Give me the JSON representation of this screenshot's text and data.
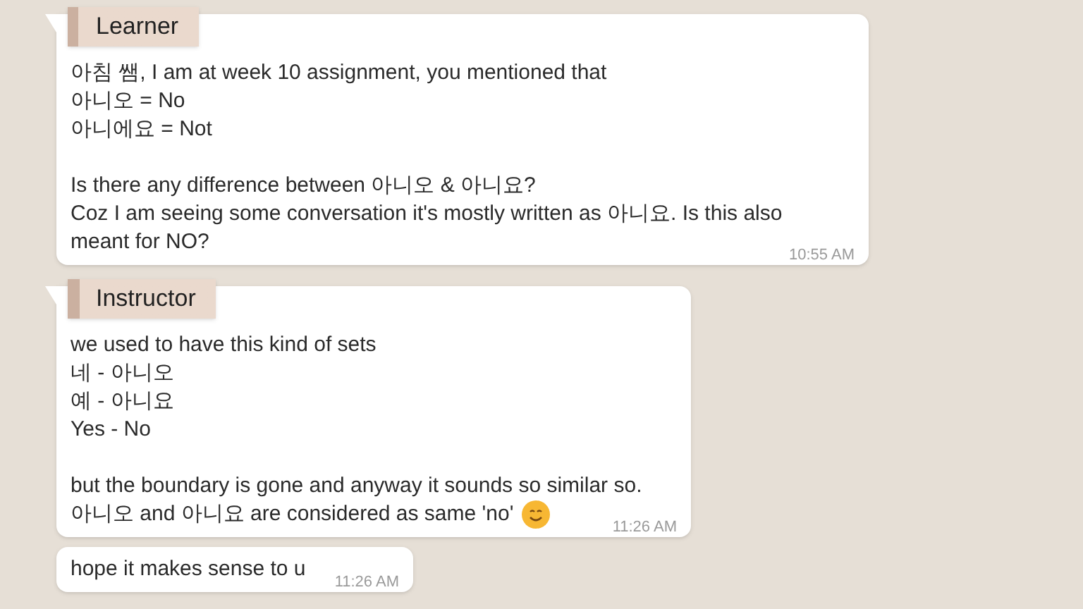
{
  "messages": [
    {
      "sender": "Learner",
      "paragraphs": [
        [
          "아침 쌤, I am at week 10 assignment, you mentioned that",
          "아니오 = No",
          "아니에요 = Not"
        ],
        [
          "Is there any difference between 아니오 & 아니요?",
          "Coz I am seeing some conversation it's mostly written as 아니요. Is this also",
          "meant for NO?"
        ]
      ],
      "emoji": false,
      "time": "10:55 AM"
    },
    {
      "sender": "Instructor",
      "paragraphs": [
        [
          "we used to have this kind of sets",
          "네 - 아니오",
          "예 - 아니요",
          "Yes - No"
        ],
        [
          "but the boundary is gone and anyway it sounds so similar so.",
          "아니오 and 아니요 are considered as same 'no'"
        ]
      ],
      "emoji": true,
      "time": "11:26 AM"
    },
    {
      "paragraphs": [
        [
          "hope it makes sense to u"
        ]
      ],
      "emoji": false,
      "time": "11:26 AM"
    }
  ]
}
